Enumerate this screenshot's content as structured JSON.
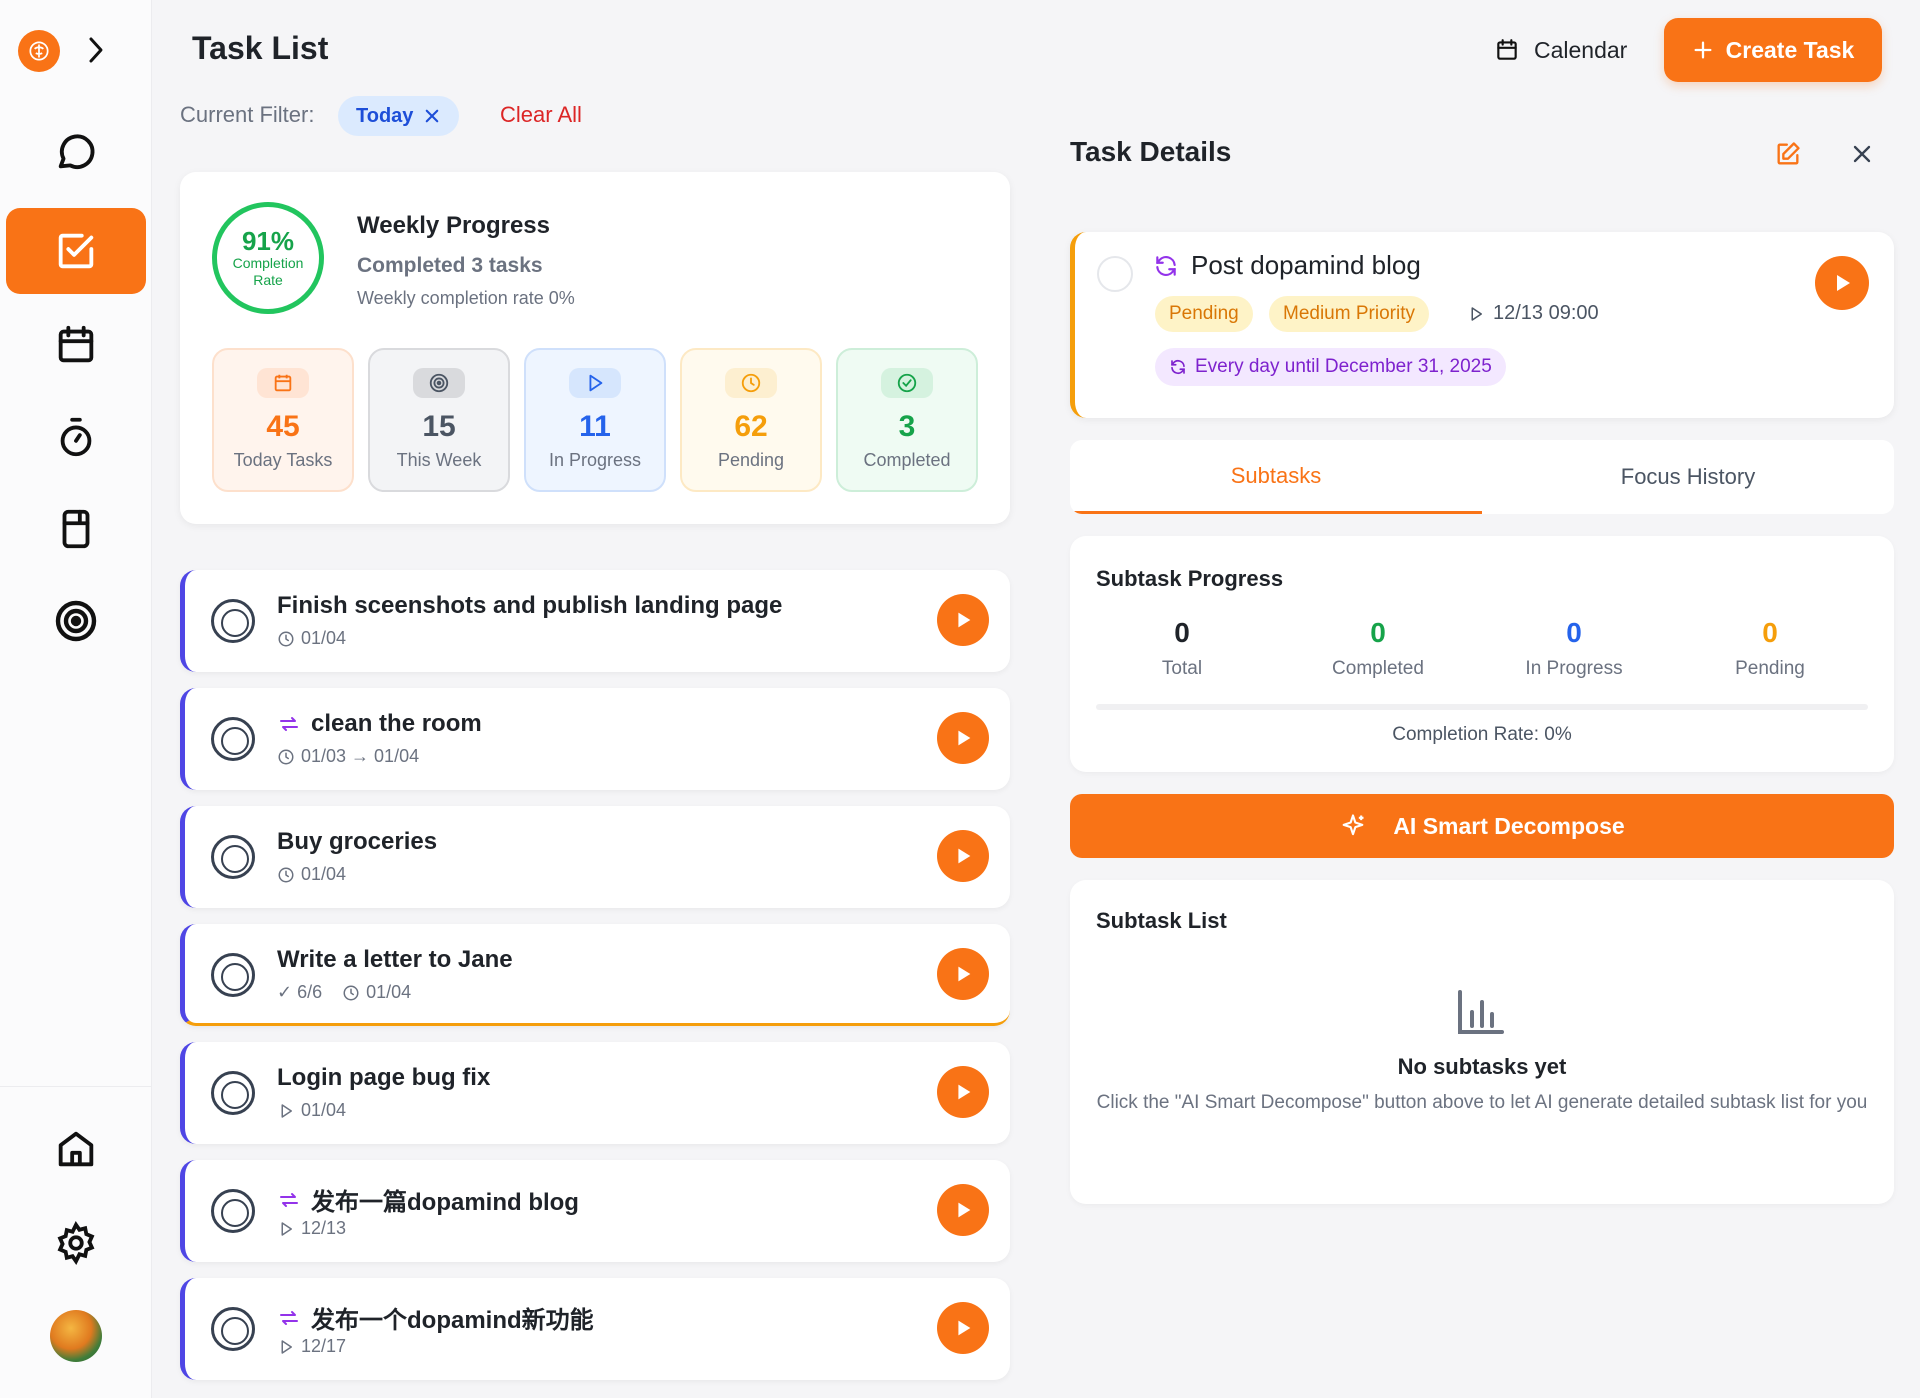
{
  "header": {
    "title": "Task List",
    "calendar_label": "Calendar",
    "create_label": "Create Task"
  },
  "filter": {
    "label": "Current Filter:",
    "chip": "Today",
    "clear_label": "Clear All"
  },
  "weekly": {
    "pct": "91%",
    "ring_label_1": "Completion",
    "ring_label_2": "Rate",
    "title": "Weekly Progress",
    "subtitle": "Completed 3 tasks",
    "rate_text": "Weekly completion rate 0%",
    "stats": [
      {
        "value": "45",
        "label": "Today Tasks",
        "color": "#f97316"
      },
      {
        "value": "15",
        "label": "This Week",
        "color": "#4b5563"
      },
      {
        "value": "11",
        "label": "In Progress",
        "color": "#2563eb"
      },
      {
        "value": "62",
        "label": "Pending",
        "color": "#f59e0b"
      },
      {
        "value": "3",
        "label": "Completed",
        "color": "#16a34a"
      }
    ]
  },
  "tasks": [
    {
      "title": "Finish sceenshots and publish landing page",
      "meta": "01/04",
      "meta_icon": "clock-icon",
      "repeat": false
    },
    {
      "title": "clean the room",
      "meta": "01/03 → 01/04",
      "meta_icon": "clock-icon",
      "repeat": true
    },
    {
      "title": "Buy groceries",
      "meta": "01/04",
      "meta_icon": "clock-icon",
      "repeat": false
    },
    {
      "title": "Write a letter to Jane",
      "meta_pre": "✓ 6/6",
      "meta": "01/04",
      "meta_icon": "clock-icon",
      "repeat": false
    },
    {
      "title": "Login page bug fix",
      "meta": "01/04",
      "meta_icon": "play-outline-icon",
      "repeat": false
    },
    {
      "title": "发布一篇dopamind blog",
      "meta": "12/13",
      "meta_icon": "play-outline-icon",
      "repeat": true
    },
    {
      "title": "发布一个dopamind新功能",
      "meta": "12/17",
      "meta_icon": "play-outline-icon",
      "repeat": true
    }
  ],
  "details": {
    "title": "Task Details",
    "task_title": "Post dopamind blog",
    "status": "Pending",
    "priority": "Medium Priority",
    "time": "12/13 09:00",
    "recurrence": "Every day until December 31, 2025",
    "tabs": [
      "Subtasks",
      "Focus History"
    ],
    "progress_title": "Subtask Progress",
    "progress": [
      {
        "value": "0",
        "label": "Total",
        "color": "#1f2329"
      },
      {
        "value": "0",
        "label": "Completed",
        "color": "#16a34a"
      },
      {
        "value": "0",
        "label": "In Progress",
        "color": "#2563eb"
      },
      {
        "value": "0",
        "label": "Pending",
        "color": "#f59e0b"
      }
    ],
    "completion_rate": "Completion Rate: 0%",
    "ai_button": "AI Smart Decompose",
    "list_title": "Subtask List",
    "empty_title": "No subtasks yet",
    "empty_hint": "Click the \"AI Smart Decompose\" button above to let AI generate detailed subtask list for you"
  }
}
